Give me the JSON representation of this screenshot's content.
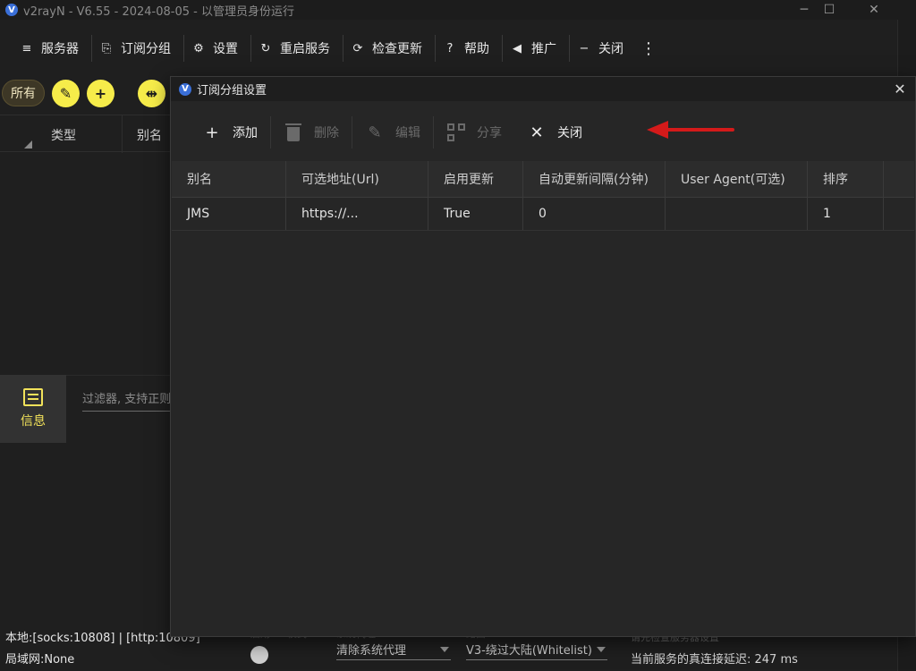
{
  "window": {
    "title": "v2rayN - V6.55 - 2024-08-05 - 以管理员身份运行",
    "logo_letter": "V",
    "minimize_icon": "─",
    "maximize_icon": "☐",
    "close_icon": "✕"
  },
  "toolbar": {
    "items": [
      {
        "label": "服务器",
        "icon": "≡"
      },
      {
        "label": "订阅分组",
        "icon": "⎘"
      },
      {
        "label": "设置",
        "icon": "⚙"
      },
      {
        "label": "重启服务",
        "icon": "↻"
      },
      {
        "label": "检查更新",
        "icon": "⟳"
      },
      {
        "label": "帮助",
        "icon": "?"
      },
      {
        "label": "推广",
        "icon": "◀"
      },
      {
        "label": "关闭",
        "icon": "−"
      }
    ],
    "more_icon": "⋮"
  },
  "groups": {
    "all_label": "所有",
    "edit_icon": "✎",
    "add_icon": "+",
    "split_icon": "⇹"
  },
  "server_list": {
    "columns": [
      "类型",
      "别名"
    ]
  },
  "info_panel": {
    "tab_label": "信息",
    "filter_placeholder": "过滤器, 支持正则"
  },
  "status_bar": {
    "local": "本地:[socks:10808] | [http:10809]",
    "lan": "局域网:None",
    "tun_label": "启用Tun模式",
    "sysproxy_label": "系统代理",
    "sysproxy_value": "清除系统代理",
    "routing_label": "路由",
    "routing_value": "V3-绕过大陆(Whitelist)",
    "server_hint": "请先检查服务器设置",
    "delay": "当前服务的真连接延迟: 247 ms"
  },
  "dialog": {
    "title": "订阅分组设置",
    "logo_letter": "V",
    "close_icon": "✕",
    "buttons": [
      {
        "label": "添加",
        "icon": "+",
        "enabled": true
      },
      {
        "label": "删除",
        "icon": "trash",
        "enabled": false
      },
      {
        "label": "编辑",
        "icon": "✎",
        "enabled": false
      },
      {
        "label": "分享",
        "icon": "qr",
        "enabled": false
      },
      {
        "label": "关闭",
        "icon": "✕",
        "enabled": true
      }
    ],
    "annotation_color": "#d41a1a",
    "grid": {
      "columns": [
        "别名",
        "可选地址(Url)",
        "启用更新",
        "自动更新间隔(分钟)",
        "User Agent(可选)",
        "排序"
      ],
      "rows": [
        [
          "JMS",
          "https://...",
          "True",
          "0",
          "",
          "1"
        ]
      ]
    }
  }
}
